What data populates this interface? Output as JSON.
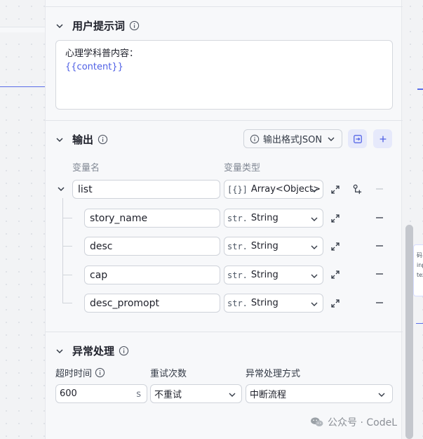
{
  "prompt": {
    "section_title": "用户提示词",
    "line1": "心理学科普内容：",
    "variable": "{{content}}"
  },
  "output": {
    "section_title": "输出",
    "format_button": "输出格式JSON",
    "col_name": "变量名",
    "col_type": "变量类型",
    "rows": [
      {
        "name": "list",
        "type_badge": "[{}]",
        "type": "Array<Object>"
      },
      {
        "name": "story_name",
        "type_badge": "str.",
        "type": "String"
      },
      {
        "name": "desc",
        "type_badge": "str.",
        "type": "String"
      },
      {
        "name": "cap",
        "type_badge": "str.",
        "type": "String"
      },
      {
        "name": "desc_promopt",
        "type_badge": "str.",
        "type": "String"
      }
    ]
  },
  "exception": {
    "section_title": "异常处理",
    "timeout_label": "超时时间",
    "timeout_value": "600",
    "timeout_unit": "s",
    "retry_label": "重试次数",
    "retry_value": "不重试",
    "method_label": "异常处理方式",
    "method_value": "中断流程"
  },
  "background": {
    "card_text_1": "码",
    "card_text_2": "inp",
    "card_text_3": "tex"
  },
  "watermark": "公众号 · CodeL",
  "colors": {
    "accent": "#4e5fe5",
    "accent_bg": "#e6e9fb",
    "panel_bg": "#f7f8fa"
  }
}
